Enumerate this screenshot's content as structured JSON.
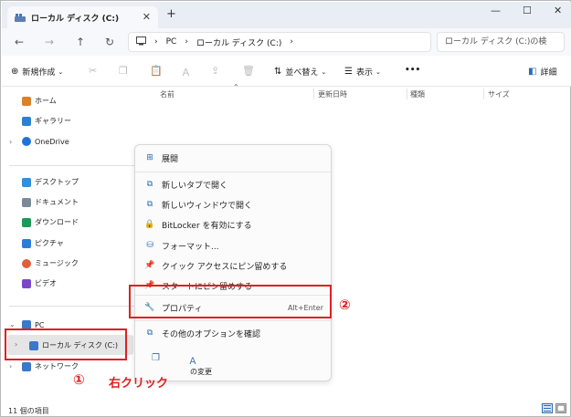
{
  "window": {
    "tab_title": "ローカル ディスク (C:)",
    "close_tab": "✕",
    "new_tab": "+",
    "minimize": "—",
    "maximize": "☐",
    "close": "✕"
  },
  "nav": {
    "back": "←",
    "forward": "→",
    "up": "↑",
    "refresh": "↻",
    "breadcrumb": [
      "PC",
      "ローカル ディスク (C:)"
    ],
    "search_placeholder": "ローカル ディスク (C:)の検"
  },
  "toolbar": {
    "new_label": "新規作成",
    "sort_label": "並べ替え",
    "view_label": "表示",
    "more_label": "•••",
    "details_label": "詳細"
  },
  "sidebar": {
    "items": [
      {
        "label": "ホーム",
        "icon": "home-icon",
        "color": "#d9822b"
      },
      {
        "label": "ギャラリー",
        "icon": "gallery-icon",
        "color": "#2f7fd1"
      },
      {
        "label": "OneDrive",
        "icon": "cloud-icon",
        "color": "#1e73d6"
      },
      {
        "label": "デスクトップ",
        "icon": "desktop-icon",
        "color": "#2f8fe0"
      },
      {
        "label": "ドキュメント",
        "icon": "document-icon",
        "color": "#7a8a9a"
      },
      {
        "label": "ダウンロード",
        "icon": "download-icon",
        "color": "#1d9a5a"
      },
      {
        "label": "ピクチャ",
        "icon": "pictures-icon",
        "color": "#2b7dd8"
      },
      {
        "label": "ミュージック",
        "icon": "music-icon",
        "color": "#e0603a"
      },
      {
        "label": "ビデオ",
        "icon": "video-icon",
        "color": "#7b47c9"
      },
      {
        "label": "PC",
        "icon": "pc-icon",
        "color": "#3a78c8"
      },
      {
        "label": "ローカル ディスク (C:)",
        "icon": "drive-icon",
        "color": "#3a78c8"
      },
      {
        "label": "ネットワーク",
        "icon": "network-icon",
        "color": "#3a78c8"
      }
    ]
  },
  "columns": [
    "名前",
    "更新日時",
    "種類",
    "サイズ"
  ],
  "context_menu": {
    "items": [
      {
        "label": "展開",
        "icon": "expand-icon"
      },
      {
        "label": "新しいタブで開く",
        "icon": "new-tab-icon"
      },
      {
        "label": "新しいウィンドウで開く",
        "icon": "new-window-icon"
      },
      {
        "label": "BitLocker を有効にする",
        "icon": "bitlocker-icon"
      },
      {
        "label": "フォーマット...",
        "icon": "format-icon"
      },
      {
        "label": "クイック アクセスにピン留めする",
        "icon": "pin-icon"
      },
      {
        "label": "スタートにピン留めする",
        "icon": "pin-start-icon"
      },
      {
        "label": "プロパティ",
        "icon": "wrench-icon",
        "shortcut": "Alt+Enter"
      },
      {
        "label": "その他のオプションを確認",
        "icon": "more-options-icon"
      }
    ],
    "bottom_fragment": "の変更"
  },
  "annotations": {
    "step1_number": "①",
    "step1_text": "右クリック",
    "step2_number": "②",
    "color": "#e02020"
  },
  "status": {
    "item_count": "11 個の項目"
  }
}
